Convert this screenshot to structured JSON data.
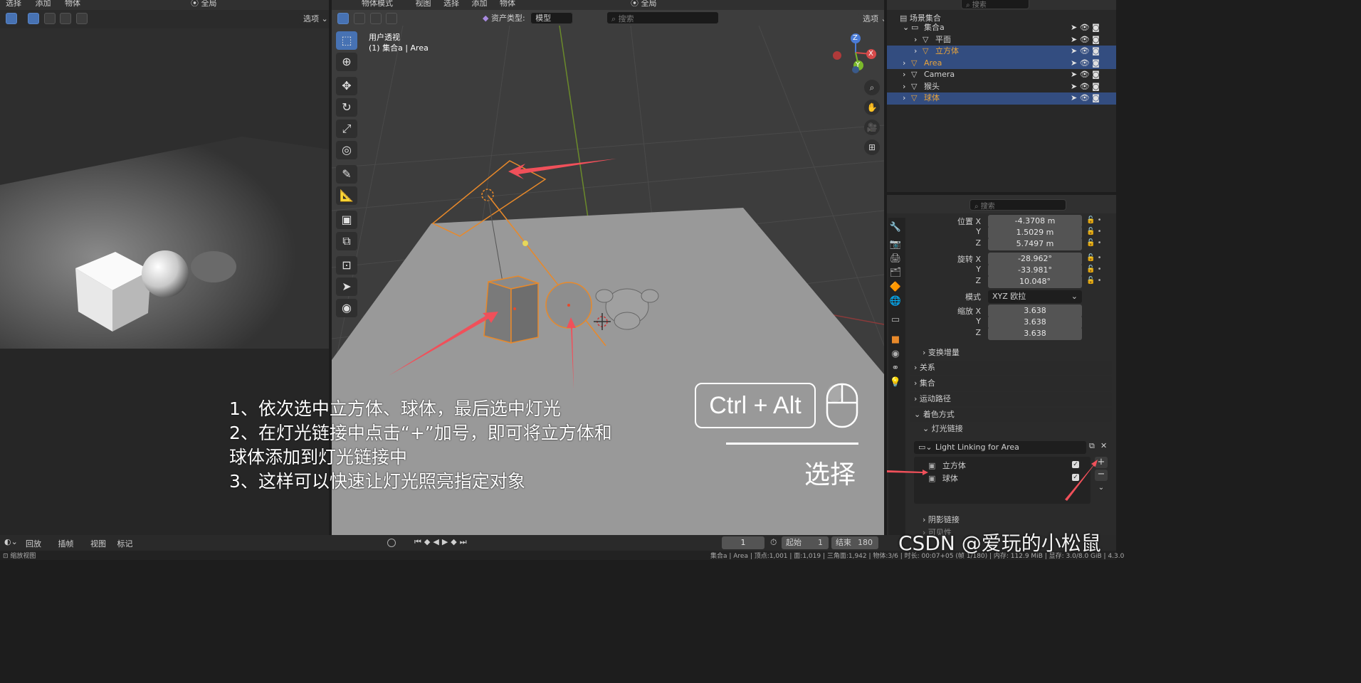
{
  "left_view": {
    "menu": [
      "选择",
      "添加",
      "物体"
    ],
    "options_label": "选项",
    "transform_label": "全局"
  },
  "main_view": {
    "mode_label": "物体模式",
    "menu": [
      "视图",
      "选择",
      "添加",
      "物体"
    ],
    "transform_label": "全局",
    "options_label": "选项",
    "asset_type_label": "资产类型:",
    "asset_type_value": "模型",
    "search_placeholder": "搜索",
    "viewport_title": "用户透视",
    "viewport_subtitle": "(1) 集合a | Area",
    "gizmo": {
      "x": "X",
      "y": "Y",
      "z": "Z"
    }
  },
  "outliner": {
    "search_placeholder": "搜索",
    "root": "场景集合",
    "items": [
      {
        "label": "集合a",
        "level": 1,
        "selected": false,
        "color": "#d0d0d0"
      },
      {
        "label": "平面",
        "level": 2,
        "selected": false,
        "color": "#d0d0d0"
      },
      {
        "label": "立方体",
        "level": 2,
        "selected": true,
        "color": "#e8a33a"
      },
      {
        "label": "Area",
        "level": 1,
        "selected": true,
        "color": "#e8a33a"
      },
      {
        "label": "Camera",
        "level": 1,
        "selected": false,
        "color": "#d0d0d0"
      },
      {
        "label": "猴头",
        "level": 1,
        "selected": false,
        "color": "#d0d0d0"
      },
      {
        "label": "球体",
        "level": 1,
        "selected": true,
        "color": "#e8a33a"
      }
    ]
  },
  "properties": {
    "search_placeholder": "搜索",
    "location_label": "位置 X",
    "location": {
      "x": "-4.3708 m",
      "y": "1.5029 m",
      "z": "5.7497 m"
    },
    "rotation_label": "旋转 X",
    "rotation": {
      "x": "-28.962°",
      "y": "-33.981°",
      "z": "10.048°"
    },
    "mode_label": "模式",
    "mode_value": "XYZ 欧拉",
    "scale_label": "缩放 X",
    "scale": {
      "x": "3.638",
      "y": "3.638",
      "z": "3.638"
    },
    "y_label": "Y",
    "z_label": "Z",
    "sections": [
      "变换增量",
      "关系",
      "集合",
      "运动路径",
      "着色方式",
      "灯光链接",
      "阴影链接",
      "可见性"
    ],
    "light_linking_name": "Light Linking for Area",
    "linked_objects": [
      "立方体",
      "球体"
    ]
  },
  "timeline": {
    "menu": [
      "回放",
      "插帧",
      "视图",
      "标记"
    ],
    "current_frame": "1",
    "start_label": "起始",
    "start_value": "1",
    "end_label": "结束",
    "end_value": "180"
  },
  "status_bar": {
    "left": "缩放视图",
    "right": "集合a | Area | 顶点:1,001 | 面:1,019 | 三角面:1,942 | 物体:3/6 | 时长: 00:07+05 (帧 1/180) | 内存: 112.9 MiB | 显存: 3.0/8.0 GiB | 4.3.0"
  },
  "overlay": {
    "instructions": [
      "1、依次选中立方体、球体，最后选中灯光",
      "2、在灯光链接中点击“+”加号，即可将立方体和",
      "球体添加到灯光链接中",
      "3、这样可以快速让灯光照亮指定对象"
    ],
    "shortcut": "Ctrl + Alt",
    "select_label": "选择",
    "watermark": "CSDN @爱玩的小松鼠"
  }
}
